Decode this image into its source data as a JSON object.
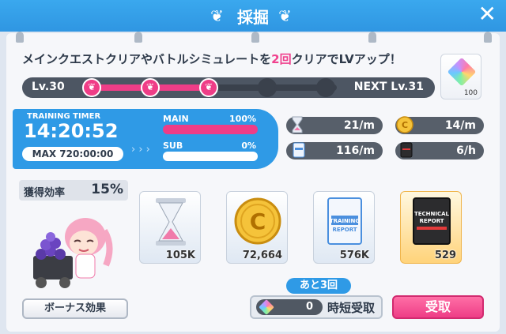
{
  "header": {
    "title": "採掘",
    "close": "✕"
  },
  "quest": {
    "prefix": "メインクエストクリアやバトルシミュレートを",
    "highlight": "2回",
    "suffix": "クリアでLVアップ！"
  },
  "level": {
    "current": "Lv.30",
    "next": "NEXT Lv.31",
    "progress_nodes": 5,
    "progress_filled": 3
  },
  "diamond_reward": {
    "count": "100"
  },
  "timer": {
    "label": "TRAINING TIMER",
    "time": "14:20:52",
    "max": "MAX 720:00:00",
    "arrows": "› › ›",
    "main_label": "MAIN",
    "main_pct": "100%",
    "main_value": 100,
    "sub_label": "SUB",
    "sub_pct": "0%",
    "sub_value": 0
  },
  "rates": {
    "hourglass": "21/m",
    "coin": "14/m",
    "report": "116/m",
    "tech_report": "6/h"
  },
  "efficiency": {
    "label": "獲得効率",
    "value": "15%"
  },
  "items": [
    {
      "icon": "hourglass-icon",
      "qty": "105K"
    },
    {
      "icon": "coin-icon",
      "qty": "72,664"
    },
    {
      "icon": "training-report-icon",
      "qty": "576K"
    },
    {
      "icon": "technical-report-icon",
      "qty": "529"
    }
  ],
  "buttons": {
    "bonus": "ボーナス効果",
    "remaining": "あと3回",
    "shorten_count": "0",
    "shorten_label": "時短受取",
    "receive": "受取"
  },
  "colors": {
    "accent_blue": "#2f9ae6",
    "accent_pink": "#ef3d87",
    "dark": "#4d5663"
  }
}
